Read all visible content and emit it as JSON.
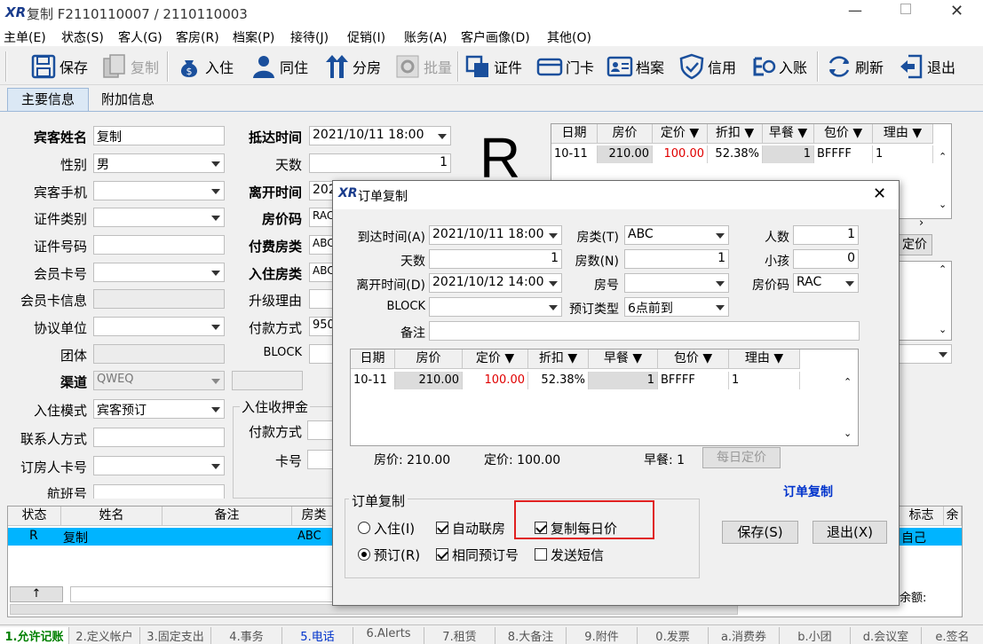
{
  "window": {
    "title": "复制  F2110110007 / 2110110003"
  },
  "menu": [
    "主单(E)",
    "状态(S)",
    "客人(G)",
    "客房(R)",
    "档案(P)",
    "接待(J)",
    "促销(I)",
    "账务(A)",
    "客户画像(D)",
    "其他(O)"
  ],
  "toolbar": {
    "save": "保存",
    "copy": "复制",
    "checkin": "入住",
    "cohabit": "同住",
    "split": "分房",
    "batch": "批量",
    "certificate": "证件",
    "door_card": "门卡",
    "profile": "档案",
    "credit": "信用",
    "post": "入账",
    "refresh": "刷新",
    "exit": "退出"
  },
  "tabs": {
    "main": "主要信息",
    "extra": "附加信息"
  },
  "status_letter": "R",
  "left_form": {
    "guest_name_label": "宾客姓名",
    "guest_name": "复制",
    "gender_label": "性别",
    "gender": "男",
    "mobile_label": "宾客手机",
    "id_type_label": "证件类别",
    "id_no_label": "证件号码",
    "member_card_label": "会员卡号",
    "member_info_label": "会员卡信息",
    "agreement_label": "协议单位",
    "group_label": "团体",
    "channel_label": "渠道",
    "channel": "QWEQ",
    "checkin_mode_label": "入住模式",
    "checkin_mode": "宾客预订",
    "contact_label": "联系人方式",
    "booker_card_label": "订房人卡号",
    "flight_label": "航班号"
  },
  "mid_form": {
    "arrival_label": "抵达时间",
    "arrival": "2021/10/11 18:00",
    "days_label": "天数",
    "days": "1",
    "depart_label": "离开时间",
    "depart": "2021/",
    "rate_code_label": "房价码",
    "rate_code": "RAC",
    "pay_room_label": "付费房类",
    "pay_room": "ABC",
    "checkin_room_label": "入住房类",
    "checkin_room": "ABC",
    "upgrade_label": "升级理由",
    "pay_method_label": "付款方式",
    "pay_method": "950",
    "block_label": "BLOCK",
    "deposit_group": "入住收押金",
    "dep_pay_label": "付款方式",
    "card_no_label": "卡号"
  },
  "bg_rate_grid": {
    "headers": [
      "日期",
      "房价",
      "定价 ▼",
      "折扣 ▼",
      "早餐 ▼",
      "包价 ▼",
      "理由 ▼"
    ],
    "row": [
      "10-11",
      "210.00",
      "100.00",
      "52.38%",
      "1",
      "BFFFF",
      "1"
    ],
    "daily_btn_fragment": "定价"
  },
  "bottom_list": {
    "headers": [
      "状态",
      "姓名",
      "备注",
      "房类"
    ],
    "right_headers": [
      "标志",
      "余"
    ],
    "row": {
      "status": "R",
      "name": "复制",
      "room_type": "ABC",
      "flag": "自己"
    },
    "balance_label": "余额:"
  },
  "dialog": {
    "title": "订单复制",
    "arrival_label": "到达时间(A)",
    "arrival": "2021/10/11 18:00",
    "room_type_label": "房类(T)",
    "room_type": "ABC",
    "people_label": "人数",
    "people": "1",
    "days_label": "天数",
    "days": "1",
    "rooms_label": "房数(N)",
    "rooms": "1",
    "children_label": "小孩",
    "children": "0",
    "depart_label": "离开时间(D)",
    "depart": "2021/10/12 14:00",
    "room_no_label": "房号",
    "rate_code_label": "房价码",
    "rate_code": "RAC",
    "block_label": "BLOCK",
    "booking_type_label": "预订类型",
    "booking_type": "6点前到",
    "remark_label": "备注",
    "grid_headers": [
      "日期",
      "房价",
      "定价 ▼",
      "折扣 ▼",
      "早餐 ▼",
      "包价 ▼",
      "理由 ▼"
    ],
    "grid_row": [
      "10-11",
      "210.00",
      "100.00",
      "52.38%",
      "1",
      "BFFFF",
      "1"
    ],
    "sum_rate": "房价: 210.00",
    "sum_fixed": "定价: 100.00",
    "sum_breakfast": "早餐: 1",
    "daily_rate_btn": "每日定价",
    "copy_link": "订单复制",
    "group_title": "订单复制",
    "opt_checkin": "入住(I)",
    "opt_reserve": "预订(R)",
    "opt_auto_link": "自动联房",
    "opt_same_no": "相同预订号",
    "opt_copy_daily": "复制每日价",
    "opt_sms": "发送短信",
    "save_btn": "保存(S)",
    "exit_btn": "退出(X)"
  },
  "bottom_tabs": [
    "1.允许记账",
    "2.定义帐户",
    "3.固定支出",
    "4.事务",
    "5.电话",
    "6.Alerts",
    "7.租赁",
    "8.大备注",
    "9.附件",
    "0.发票",
    "a.消费券",
    "b.小团",
    "d.会议室",
    "e.签名"
  ],
  "colors": {
    "red": "#e00000",
    "blue_link": "#0033cc",
    "highlight": "#00b4ff",
    "red_box": "#e02020",
    "green_tab": "#008000"
  }
}
